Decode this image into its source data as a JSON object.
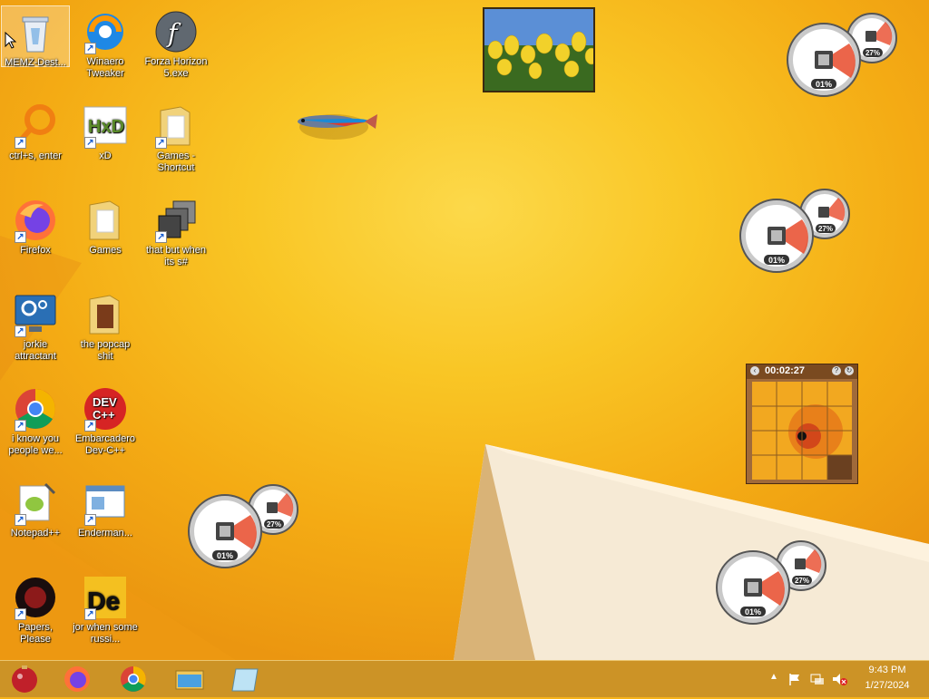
{
  "desktop_icons": [
    {
      "label": "MEMZ-Dest...",
      "icon": "recycle-bin-icon"
    },
    {
      "label": "Winaero Tweaker",
      "icon": "winaero-icon"
    },
    {
      "label": "Forza Horizon 5.exe",
      "icon": "flash-icon"
    },
    {
      "label": "ctrl+s, enter",
      "icon": "magnifier-icon"
    },
    {
      "label": "xD",
      "icon": "hxd-icon"
    },
    {
      "label": "Games - Shortcut",
      "icon": "folder-icon"
    },
    {
      "label": "Firefox",
      "icon": "firefox-icon"
    },
    {
      "label": "Games",
      "icon": "folder-icon"
    },
    {
      "label": "that but when its s#",
      "icon": "stack-icon"
    },
    {
      "label": "jorkie attractant",
      "icon": "gear-monitor-icon"
    },
    {
      "label": "the popcap shit",
      "icon": "folder-icon"
    },
    {
      "label": "i know you people we...",
      "icon": "chrome-icon"
    },
    {
      "label": "Embarcadero Dev-C++",
      "icon": "devcpp-icon"
    },
    {
      "label": "Notepad++",
      "icon": "notepadpp-icon"
    },
    {
      "label": "Enderman...",
      "icon": "window-icon"
    },
    {
      "label": "Papers, Please",
      "icon": "papers-please-icon"
    },
    {
      "label": "jor when some russi...",
      "icon": "de-icon"
    }
  ],
  "meters": {
    "cpu": "01%",
    "memory": "27%"
  },
  "puzzle": {
    "timer": "00:02:27"
  },
  "tray": {
    "time": "9:43 PM",
    "date": "1/27/2024"
  },
  "taskbar_items": [
    "start-orb",
    "firefox",
    "chrome",
    "file-explorer",
    "notepad"
  ],
  "devcpp_text": {
    "line1": "DEV",
    "line2": "C++"
  },
  "hxd_text": "HxD",
  "de_text": "De"
}
